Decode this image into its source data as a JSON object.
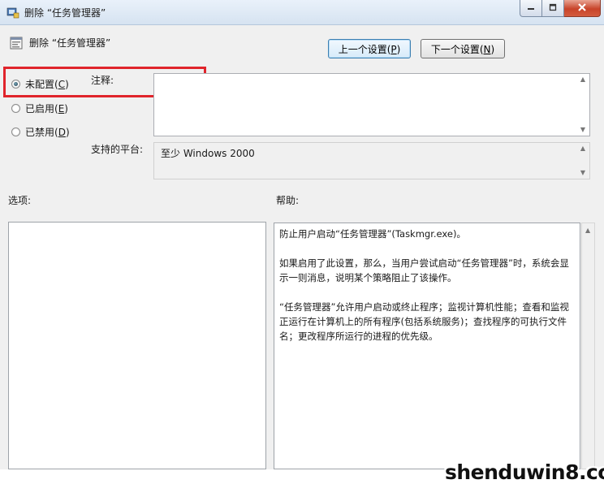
{
  "window": {
    "title": "删除 “任务管理器”",
    "minimize_icon": "minimize-icon",
    "maximize_icon": "maximize-icon",
    "close_icon": "close-icon"
  },
  "header": {
    "setting_name": "删除 “任务管理器”",
    "icon": "policy-setting-icon"
  },
  "nav": {
    "prev_label": "上一个设置(",
    "prev_key": "P",
    "prev_suffix": ")",
    "next_label": "下一个设置(",
    "next_key": "N",
    "next_suffix": ")"
  },
  "state": {
    "options": [
      {
        "label": "未配置(",
        "key": "C",
        "suffix": ")",
        "checked": true
      },
      {
        "label": "已启用(",
        "key": "E",
        "suffix": ")",
        "checked": false
      },
      {
        "label": "已禁用(",
        "key": "D",
        "suffix": ")",
        "checked": false
      }
    ]
  },
  "comment": {
    "label": "注释:",
    "value": ""
  },
  "platform": {
    "label": "支持的平台:",
    "value": "至少 Windows 2000"
  },
  "options_section": {
    "label": "选项:"
  },
  "help_section": {
    "label": "帮助:",
    "paragraphs": [
      "防止用户启动“任务管理器”(Taskmgr.exe)。",
      "如果启用了此设置，那么，当用户尝试启动“任务管理器”时，系统会显示一则消息，说明某个策略阻止了该操作。",
      "“任务管理器”允许用户启动或终止程序；监视计算机性能；查看和监视正运行在计算机上的所有程序(包括系统服务)；查找程序的可执行文件名；更改程序所运行的进程的优先级。"
    ]
  },
  "watermark": "shenduwin8.com",
  "colors": {
    "highlight": "#e0242b",
    "titlebar": "#dce8f5",
    "close": "#c8442a"
  }
}
